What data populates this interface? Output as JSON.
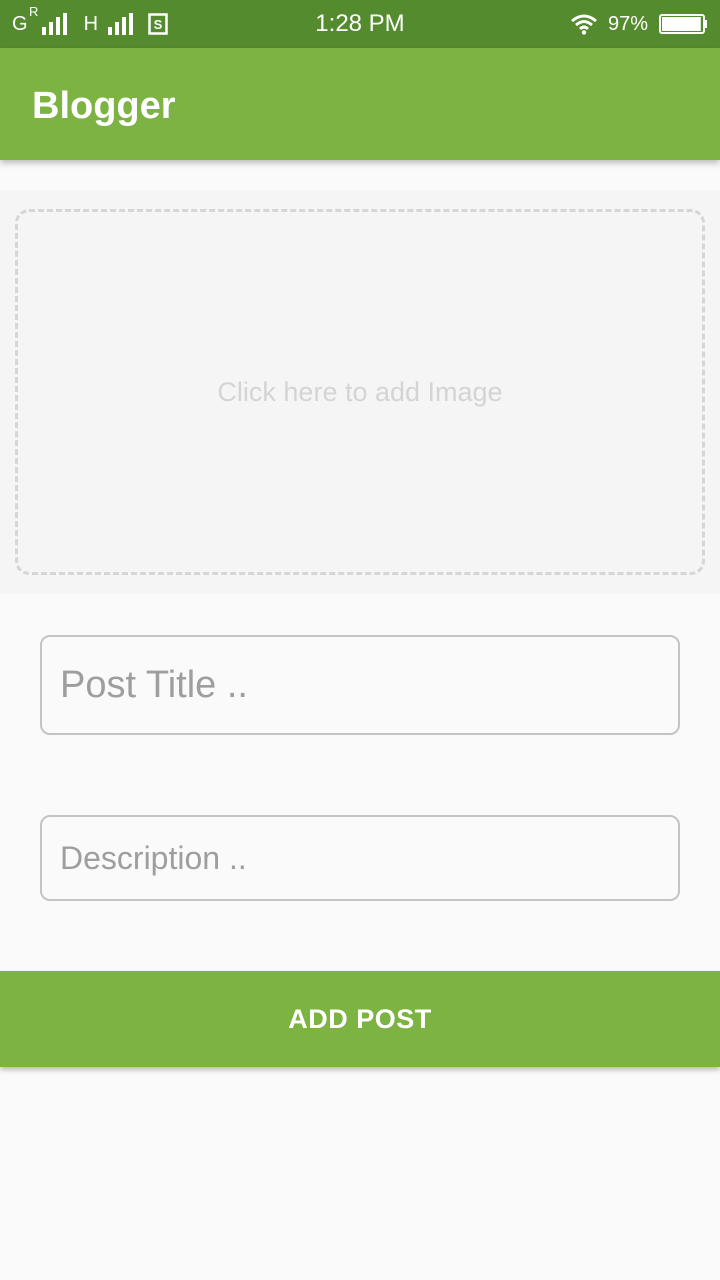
{
  "status_bar": {
    "network_1": "G",
    "network_1_roaming": "R",
    "network_2": "H",
    "sim_icon": "sim-card-s-icon",
    "time": "1:28 PM",
    "wifi_icon": "wifi-icon",
    "battery_percent": "97%",
    "battery_level": 0.97
  },
  "app_bar": {
    "title": "Blogger"
  },
  "image_picker": {
    "hint": "Click here to add Image"
  },
  "form": {
    "title_placeholder": "Post Title ..",
    "title_value": "",
    "description_placeholder": "Description ..",
    "description_value": ""
  },
  "actions": {
    "add_post_label": "ADD POST"
  },
  "colors": {
    "status_bar": "#558b2f",
    "primary": "#7cb342",
    "background": "#fafafa",
    "image_area": "#f5f5f5"
  }
}
